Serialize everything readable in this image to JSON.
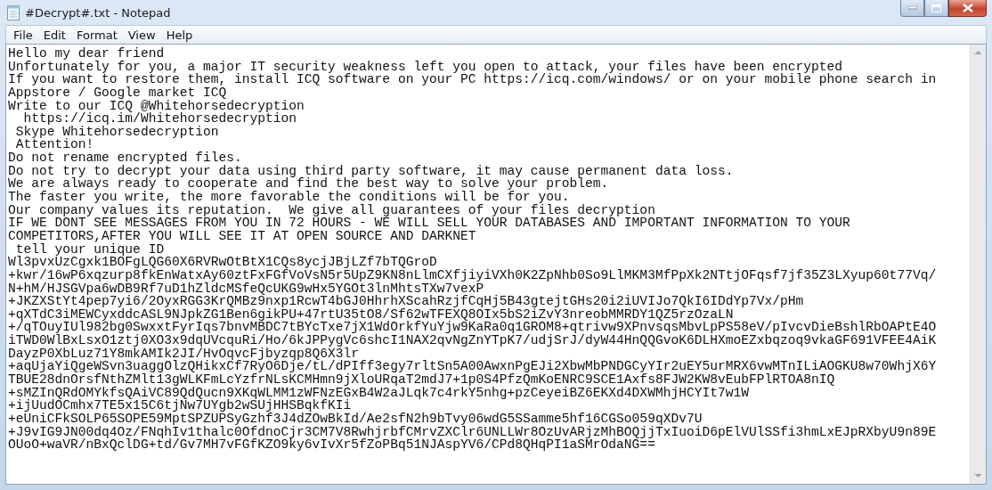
{
  "window": {
    "title": "#Decrypt#.txt - Notepad"
  },
  "menu": [
    {
      "label": "File"
    },
    {
      "label": "Edit"
    },
    {
      "label": "Format"
    },
    {
      "label": "View"
    },
    {
      "label": "Help"
    }
  ],
  "document": {
    "lines": [
      "Hello my dear friend",
      "Unfortunately for you, a major IT security weakness left you open to attack, your files have been encrypted",
      "If you want to restore them, install ICQ software on your PC https://icq.com/windows/ or on your mobile phone search in",
      "Appstore / Google market ICQ",
      "Write to our ICQ @Whitehorsedecryption",
      "  https://icq.im/Whitehorsedecryption",
      " Skype Whitehorsedecryption",
      " Attention!",
      "Do not rename encrypted files.",
      "Do not try to decrypt your data using third party software, it may cause permanent data loss.",
      "We are always ready to cooperate and find the best way to solve your problem.",
      "The faster you write, the more favorable the conditions will be for you.",
      "Our company values its reputation.  We give all guarantees of your files decryption",
      "IF WE DONT SEE MESSAGES FROM YOU IN 72 HOURS - WE WILL SELL YOUR DATABASES AND IMPORTANT INFORMATION TO YOUR",
      "COMPETITORS,AFTER YOU WILL SEE IT AT OPEN SOURCE AND DARKNET",
      " tell your unique ID",
      "Wl3pvxUzCgxk1BOFgLQG60X6RVRwOtBtX1CQs8ycjJBjLZf7bTQGroD",
      "+kwr/16wP6xqzurp8fkEnWatxAy60ztFxFGfVoVsN5r5UpZ9KN8nLlmCXfjiyiVXh0K2ZpNhb0So9LlMKM3MfPpXk2NTtjOFqsf7jf35Z3LXyup60t77Vq/",
      "N+hM/HJSGVpa6wDB9Rf7uD1hZldcMSfeQcUKG9wHx5YGOt3lnMhtsTXw7vexP",
      "+JKZXStYt4pep7yi6/2OyxRGG3KrQMBz9nxp1RcwT4bGJ0HhrhXScahRzjfCqHj5B43gtejtGHs20i2iUVIJo7QkI6IDdYp7Vx/pHm",
      "+qXTdC3iMEWCyxddcASL9NJpkZG1Ben6gikPU+47rtU35tO8/Sf62wTFEXQ8OIx5bS2iZvY3nreobMMRDY1QZ5rzOzaLN",
      "+/qTOuyIUl982bg0SwxxtFyrIqs7bnvMBDC7tBYcTxe7jX1WdOrkfYuYjw9KaRa0q1GROM8+qtrivw9XPnvsqsMbvLpPS58eV/pIvcvDieBshlRbOAPtE4O",
      "iTWD0WlBxLsxO1ztj0XO3x9dqUVcquRi/Ho/6kJPPygVc6shcI1NAX2qvNgZnYTpK7/udjSrJ/dyW44HnQQGvoK6DLHXmoEZxbqzoq9vkaGF691VFEE4AiK",
      "DayzP0XbLuz71Y8mkAMIk2JI/HvOqvcFjbyzqp8Q6X3lr",
      "+aqUjaYiQgeWSvn3uaggOlzQHikxCf7RyO6Dje/tL/dPIff3egy7rltSn5A00AwxnPgEJi2XbwMbPNDGCyYIr2uEY5urMRX6vwMTnILiAOGKU8w70WhjX6Y",
      "TBUE28dnOrsfNthZMlt13gWLKFmLcYzfrNLsKCMHmn9jXloURqaT2mdJ7+1p0S4PfzQmKoENRC9SCE1Axfs8FJW2KW8vEubFPlRTOA8nIQ",
      "+sMZInQRdOMYkfsQAiVC89QdQucn9XKqWLMM1zWFNzEGxB4W2aJLqk7c4rkY5nhg+pzCeyeiBZ6EKXd4DXWMhjHCYIt7w1W",
      "+ijUudOCmhx7TE5x15C6tjNw7UYgb2wSUjHHSBqkfKIi",
      "+eUniCFkSOLP65SOPE59MptSPZUPSyGzhf3J4dZOwBkId/Ae2sfN2h9bTvy06wdG5SSamme5hf16CGSo059qXDv7U",
      "+J9vIG9JN00dq4Oz/FNqhIv1thalc0OfdnoCjr3CM7V8RwhjrbfCMrvZXClr6UNLLWr8OzUvARjzMhBOQjjTxIuoiD6pElVUlSSfi3hmLxEJpRXbyU9n89E",
      "OUoO+waVR/nBxQclDG+td/Gv7MH7vFGfKZO9ky6vIvXr5fZoPBq51NJAspYV6/CPd8QHqPI1aSMrOdaNG=="
    ]
  }
}
